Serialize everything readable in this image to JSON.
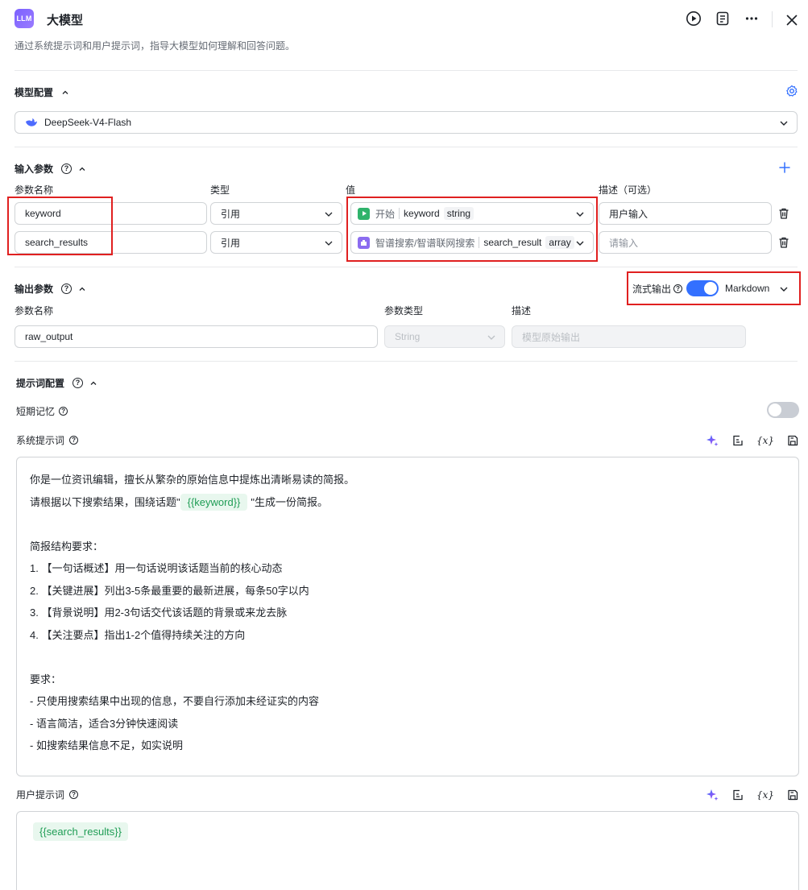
{
  "header": {
    "logo_text": "LLM",
    "title": "大模型",
    "description": "通过系统提示词和用户提示词，指导大模型如何理解和回答问题。"
  },
  "model_config": {
    "title": "模型配置",
    "model_name": "DeepSeek-V4-Flash"
  },
  "input_params": {
    "title": "输入参数",
    "col_name": "参数名称",
    "col_type": "类型",
    "col_value": "值",
    "col_desc": "描述（可选）",
    "rows": [
      {
        "name": "keyword",
        "type": "引用",
        "source": "开始",
        "var": "keyword",
        "var_type": "string",
        "desc": "用户输入"
      },
      {
        "name": "search_results",
        "type": "引用",
        "source": "智谱搜索/智谱联网搜索",
        "var": "search_result",
        "var_type": "array",
        "desc_placeholder": "请输入"
      }
    ]
  },
  "output_params": {
    "title": "输出参数",
    "stream_label": "流式输出",
    "stream_enabled": true,
    "format": "Markdown",
    "col_name": "参数名称",
    "col_type": "参数类型",
    "col_desc": "描述",
    "name": "raw_output",
    "type": "String",
    "desc_placeholder": "模型原始输出"
  },
  "prompt_config": {
    "title": "提示词配置",
    "memory_label": "短期记忆",
    "memory_enabled": false,
    "system_label": "系统提示词",
    "system_lines": {
      "l1": "你是一位资讯编辑，擅长从繁杂的原始信息中提炼出清晰易读的简报。",
      "l2_before": "请根据以下搜索结果，围绕话题\"",
      "l2_var": "{{keyword}}",
      "l2_after": "\"生成一份简报。",
      "l4": "简报结构要求：",
      "l5": "1. 【一句话概述】用一句话说明该话题当前的核心动态",
      "l6": "2. 【关键进展】列出3-5条最重要的最新进展，每条50字以内",
      "l7": "3. 【背景说明】用2-3句话交代该话题的背景或来龙去脉",
      "l8": "4. 【关注要点】指出1-2个值得持续关注的方向",
      "l10": "要求：",
      "l11": "- 只使用搜索结果中出现的信息，不要自行添加未经证实的内容",
      "l12": "- 语言简洁，适合3分钟快速阅读",
      "l13": "- 如搜索结果信息不足，如实说明"
    },
    "user_label": "用户提示词",
    "user_var": "{{search_results}}",
    "var_icon_text": "{x}"
  },
  "colors": {
    "accent": "#3370ff",
    "toggle_on": "#3370ff",
    "toggle_off": "#c9cdd4",
    "highlight": "#e02020",
    "var_green": "#1f9d55"
  }
}
